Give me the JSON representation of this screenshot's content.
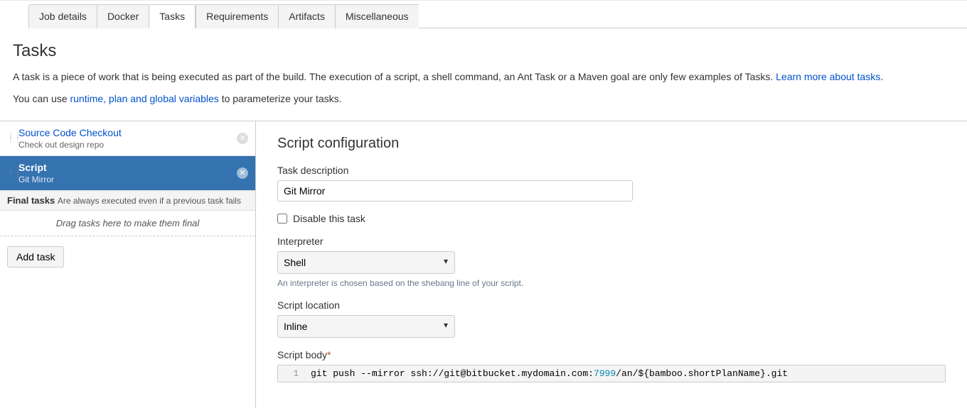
{
  "tabs": [
    {
      "label": "Job details"
    },
    {
      "label": "Docker"
    },
    {
      "label": "Tasks",
      "active": true
    },
    {
      "label": "Requirements"
    },
    {
      "label": "Artifacts"
    },
    {
      "label": "Miscellaneous"
    }
  ],
  "page": {
    "title": "Tasks",
    "desc_pre": "A task is a piece of work that is being executed as part of the build. The execution of a script, a shell command, an Ant Task or a Maven goal are only few examples of Tasks. ",
    "desc_link": "Learn more about tasks",
    "desc_post": ".",
    "desc2_pre": "You can use ",
    "desc2_link": "runtime, plan and global variables",
    "desc2_post": " to parameterize your tasks."
  },
  "sidebar": {
    "tasks": [
      {
        "title": "Source Code Checkout",
        "sub": "Check out design repo",
        "selected": false
      },
      {
        "title": "Script",
        "sub": "Git Mirror",
        "selected": true
      }
    ],
    "final_tasks_label": "Final tasks",
    "final_tasks_sub": "Are always executed even if a previous task fails",
    "drop_zone": "Drag tasks here to make them final",
    "add_task_label": "Add task"
  },
  "detail": {
    "heading": "Script configuration",
    "task_description_label": "Task description",
    "task_description_value": "Git Mirror",
    "disable_label": "Disable this task",
    "disable_checked": false,
    "interpreter_label": "Interpreter",
    "interpreter_value": "Shell",
    "interpreter_hint": "An interpreter is chosen based on the shebang line of your script.",
    "script_location_label": "Script location",
    "script_location_value": "Inline",
    "script_body_label": "Script body",
    "script_body_line_no": "1",
    "script_body_code": "git push --mirror ssh://git@bitbucket.mydomain.com:7999/an/${bamboo.shortPlanName}.git"
  }
}
